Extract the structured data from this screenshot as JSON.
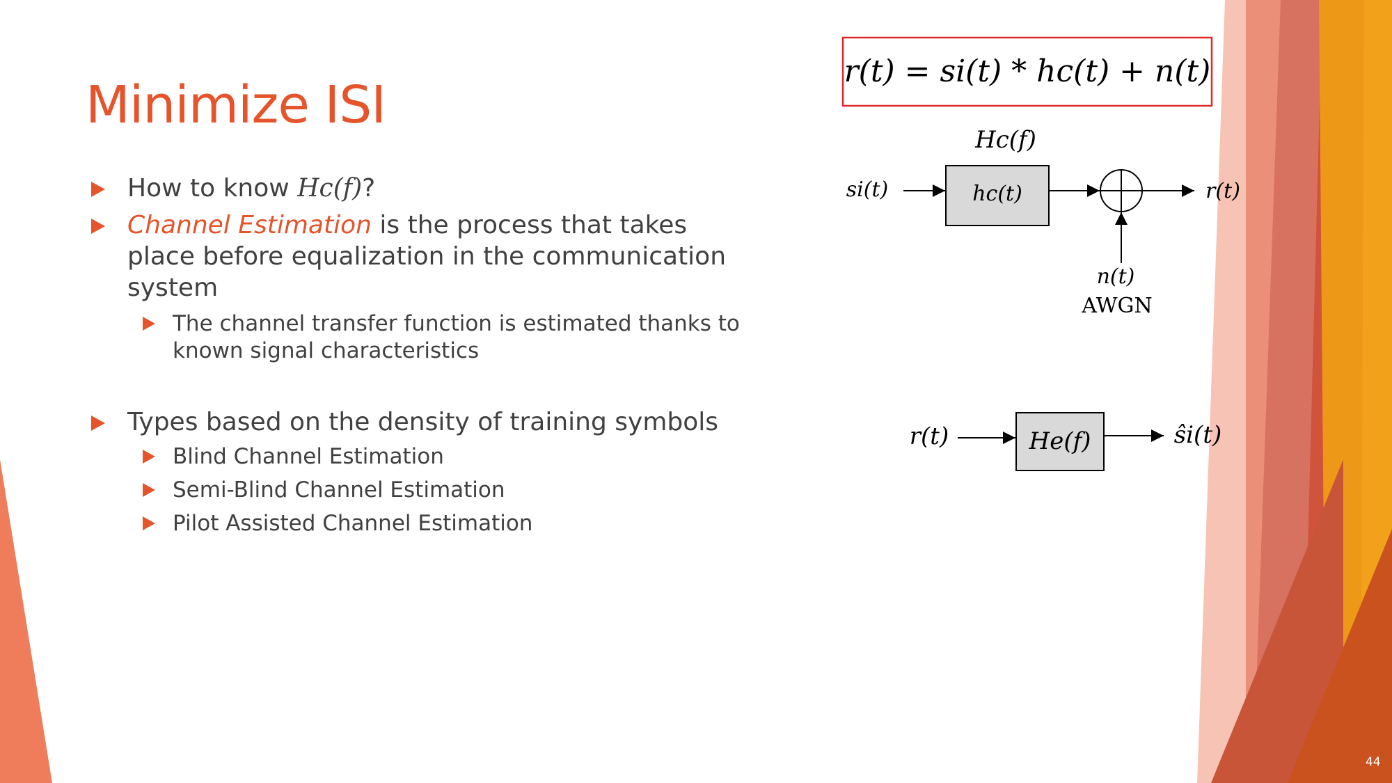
{
  "slide": {
    "title": "Minimize ISI",
    "page_number": "44"
  },
  "bullets": {
    "b1": {
      "pre": "How to know ",
      "math": "Hc(f)",
      "post": "?"
    },
    "b2": {
      "accent": "Channel Estimation",
      "rest": " is the process that takes place before equalization in the communication system"
    },
    "b2_sub": "The channel transfer function is estimated thanks to known signal characteristics",
    "b3": "Types based on the density of training symbols",
    "b3_subs": [
      "Blind Channel Estimation",
      "Semi-Blind Channel Estimation",
      "Pilot Assisted Channel Estimation"
    ]
  },
  "equation": "r(t) = si(t) * hc(t) + n(t)",
  "diagram1": {
    "top_label": "Hc(f)",
    "input": "si(t)",
    "block": "hc(t)",
    "output": "r(t)",
    "noise": "n(t)",
    "noise_type": "AWGN"
  },
  "diagram2": {
    "input": "r(t)",
    "block": "He(f)",
    "output": "ŝi(t)"
  },
  "colors": {
    "accent": "#e5542a",
    "equation_border": "#e02828",
    "block_fill": "#d9d9d9"
  }
}
